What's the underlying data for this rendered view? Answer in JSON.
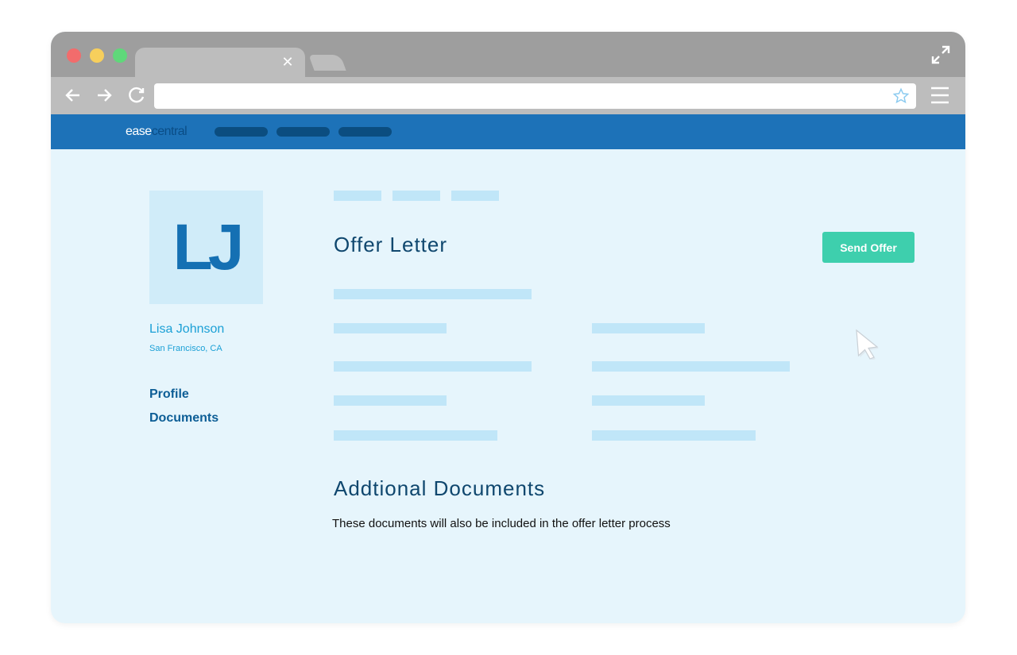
{
  "browser": {
    "tab_close_glyph": "✕",
    "url": ""
  },
  "app": {
    "logo_part1": "ease",
    "logo_part2": "central",
    "nav_items_count_note": ""
  },
  "profile": {
    "initials": "LJ",
    "name": "Lisa Johnson",
    "location": "San Francisco, CA"
  },
  "sidebar": {
    "items": [
      {
        "label": "Profile"
      },
      {
        "label": "Documents"
      }
    ]
  },
  "main": {
    "title": "Offer Letter",
    "send_button": "Send Offer",
    "additional_title": "Addtional Documents",
    "additional_desc": "These documents will also be included in the offer letter process"
  },
  "colors": {
    "app_bar": "#1d72b8",
    "accent_button": "#3ecfad",
    "content_bg": "#e6f5fc",
    "placeholder_bar": "#c0e6f8"
  }
}
